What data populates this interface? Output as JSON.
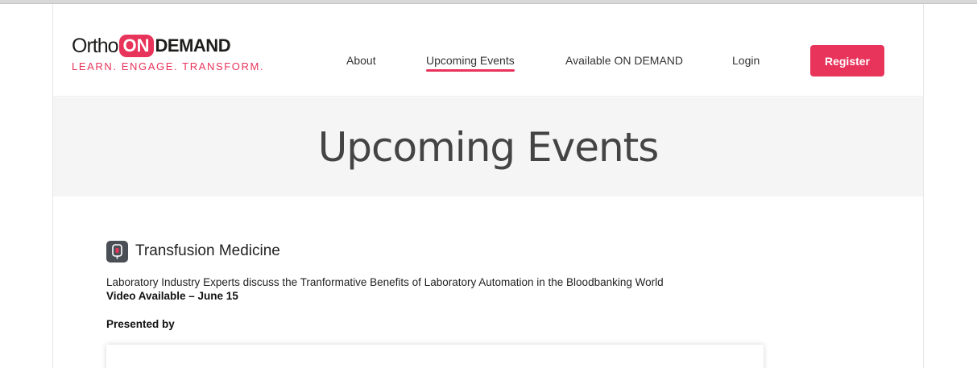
{
  "logo": {
    "ortho": "Ortho",
    "on": "ON",
    "demand": "DEMAND",
    "tagline": "LEARN. ENGAGE. TRANSFORM."
  },
  "nav": {
    "items": [
      {
        "label": "About",
        "active": false
      },
      {
        "label": "Upcoming Events",
        "active": true
      },
      {
        "label": "Available ON DEMAND",
        "active": false
      },
      {
        "label": "Login",
        "active": false
      }
    ],
    "register_label": "Register"
  },
  "hero": {
    "title": "Upcoming Events"
  },
  "event": {
    "icon": "blood-bag-icon",
    "title": "Transfusion Medicine",
    "description": "Laboratory Industry Experts discuss the Tranformative Benefits of Laboratory Automation in the Bloodbanking World",
    "availability": "Video Available – June 15",
    "presented_by_label": "Presented by"
  },
  "colors": {
    "accent": "#e8335a",
    "hero_bg": "#f5f5f5",
    "icon_bg": "#4a4f56"
  }
}
